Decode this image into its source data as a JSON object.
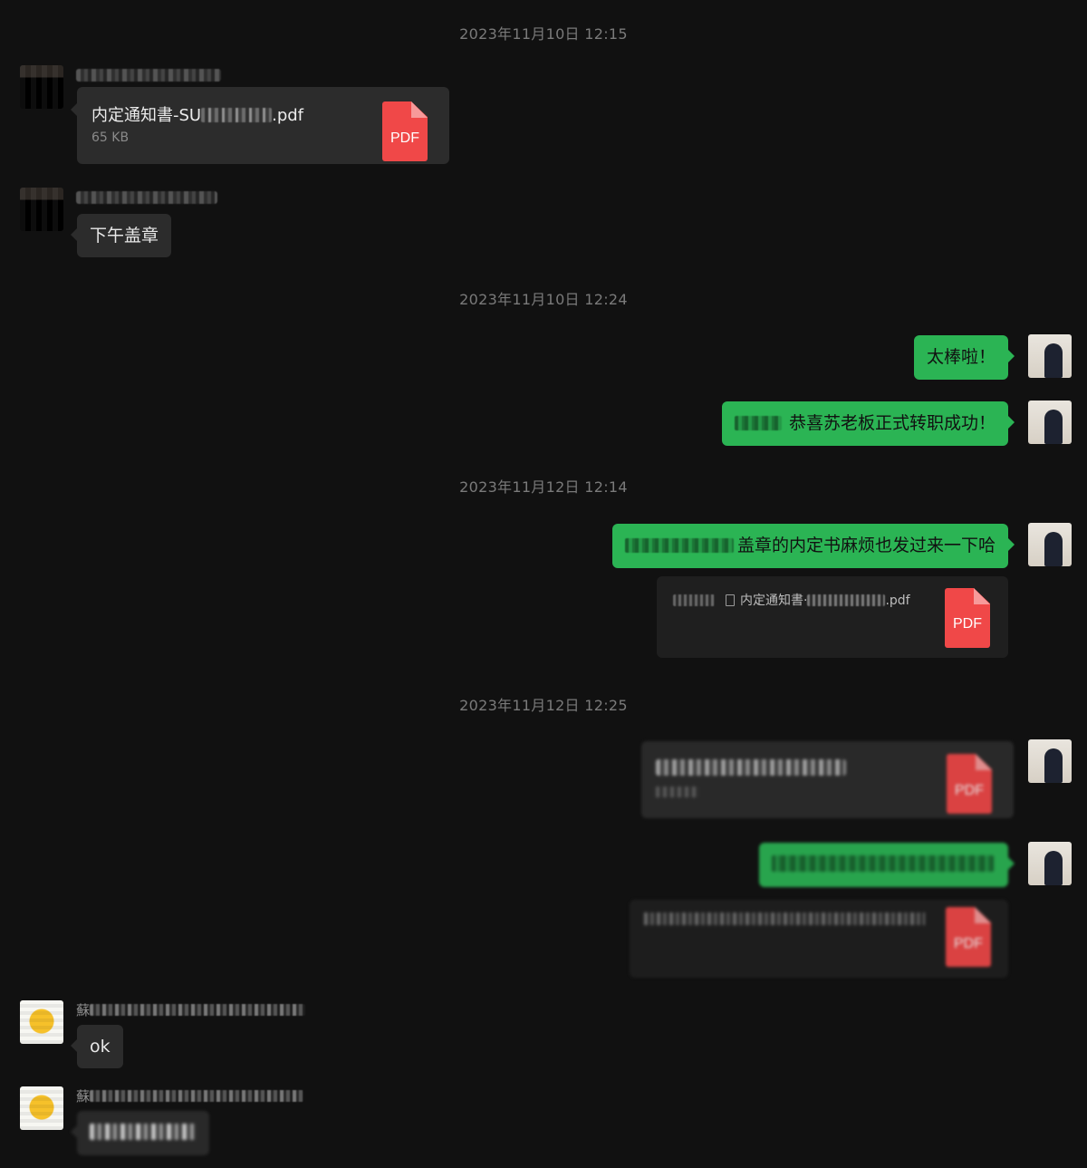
{
  "timestamps": [
    "2023年11月10日 12:15",
    "2023年11月10日 12:24",
    "2023年11月12日 12:14",
    "2023年11月12日 12:25"
  ],
  "messages": {
    "m1": {
      "file_name_prefix": "内定通知書-SU",
      "file_name_suffix": ".pdf",
      "file_size": "65 KB",
      "file_type": "PDF"
    },
    "m2": {
      "text": "下午盖章"
    },
    "m3": {
      "text": "太棒啦！"
    },
    "m4": {
      "text": "恭喜苏老板正式转职成功！"
    },
    "m5": {
      "text": "盖章的内定书麻烦也发过来一下哈"
    },
    "m6": {
      "file_name_prefix": "内定通知書·",
      "file_name_suffix": ".pdf",
      "file_type": "PDF"
    },
    "m7": {
      "file_type": "PDF"
    },
    "m8": {
      "file_type": "PDF"
    },
    "m9": {
      "sender_prefix": "蘇",
      "text": "ok"
    },
    "m10": {
      "sender_prefix": "蘇"
    }
  },
  "colors": {
    "background": "#111111",
    "incoming_bubble": "#2c2c2c",
    "outgoing_bubble": "#2bb454",
    "pdf_icon": "#f04848",
    "timestamp": "#7a7a7a"
  },
  "icons": {
    "file": "pdf-file-icon",
    "document": "document-icon"
  }
}
